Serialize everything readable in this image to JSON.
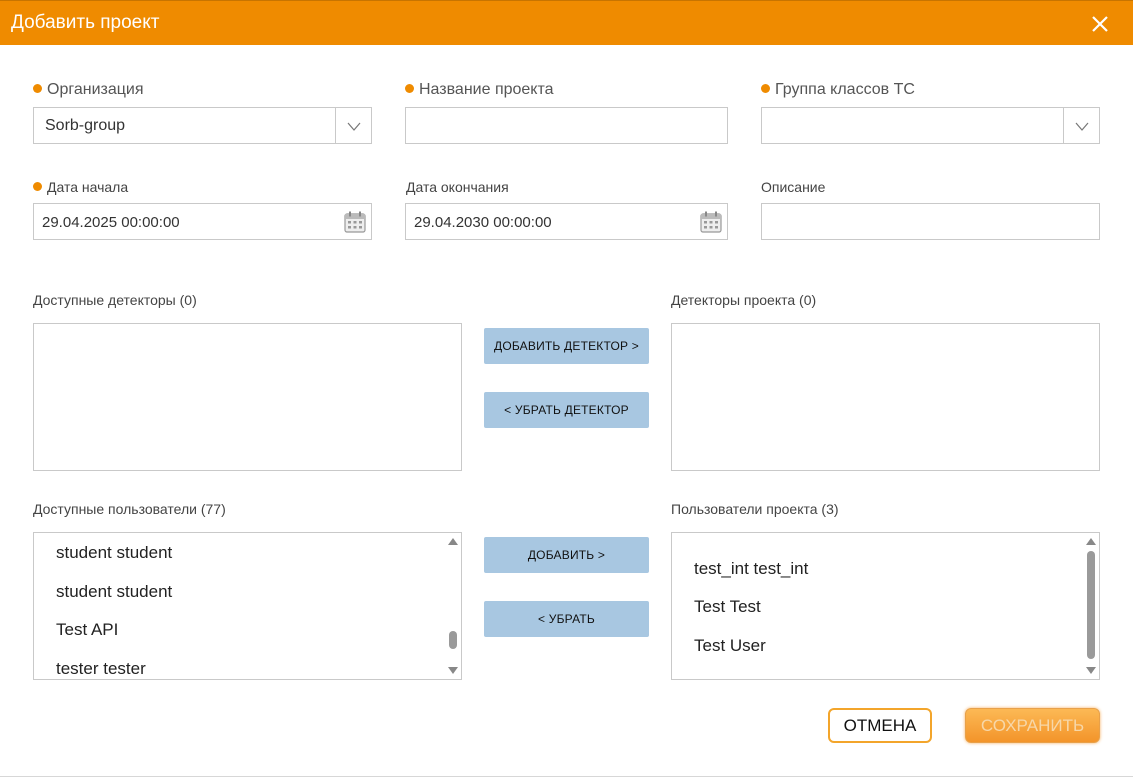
{
  "dialog": {
    "title": "Добавить проект",
    "close_icon": "close-icon"
  },
  "form": {
    "organization": {
      "label": "Организация",
      "value": "Sorb-group",
      "required": true
    },
    "project_name": {
      "label": "Название проекта",
      "value": "",
      "required": true
    },
    "vehicle_class_group": {
      "label": "Группа классов ТС",
      "value": "",
      "required": true
    },
    "start_date": {
      "label": "Дата начала",
      "value": "29.04.2025 00:00:00",
      "required": true
    },
    "end_date": {
      "label": "Дата окончания",
      "value": "29.04.2030 00:00:00",
      "required": false
    },
    "description": {
      "label": "Описание",
      "value": "",
      "required": false
    }
  },
  "detectors": {
    "available_label": "Доступные детекторы (0)",
    "project_label": "Детекторы проекта (0)",
    "add_button": "ДОБАВИТЬ ДЕТЕКТОР >",
    "remove_button": "< УБРАТЬ ДЕТЕКТОР"
  },
  "users": {
    "available_label": "Доступные пользователи (77)",
    "project_label": "Пользователи проекта (3)",
    "available_items": [
      "student student",
      "student student",
      "Test API",
      "tester tester"
    ],
    "project_items": [
      "test_int test_int",
      "Test Test",
      "Test User"
    ],
    "add_button": "ДОБАВИТЬ >",
    "remove_button": "< УБРАТЬ"
  },
  "footer": {
    "cancel_button": "ОТМЕНА",
    "save_button": "СОХРАНИТЬ"
  },
  "colors": {
    "accent": "#ef8b00",
    "transfer_button": "#a8c7e1",
    "save_button": "#f3942a"
  },
  "icons": {
    "dropdown": "chevron-down-icon",
    "calendar": "calendar-icon",
    "scroll_up": "scroll-up-arrow-icon",
    "scroll_down": "scroll-down-arrow-icon"
  }
}
